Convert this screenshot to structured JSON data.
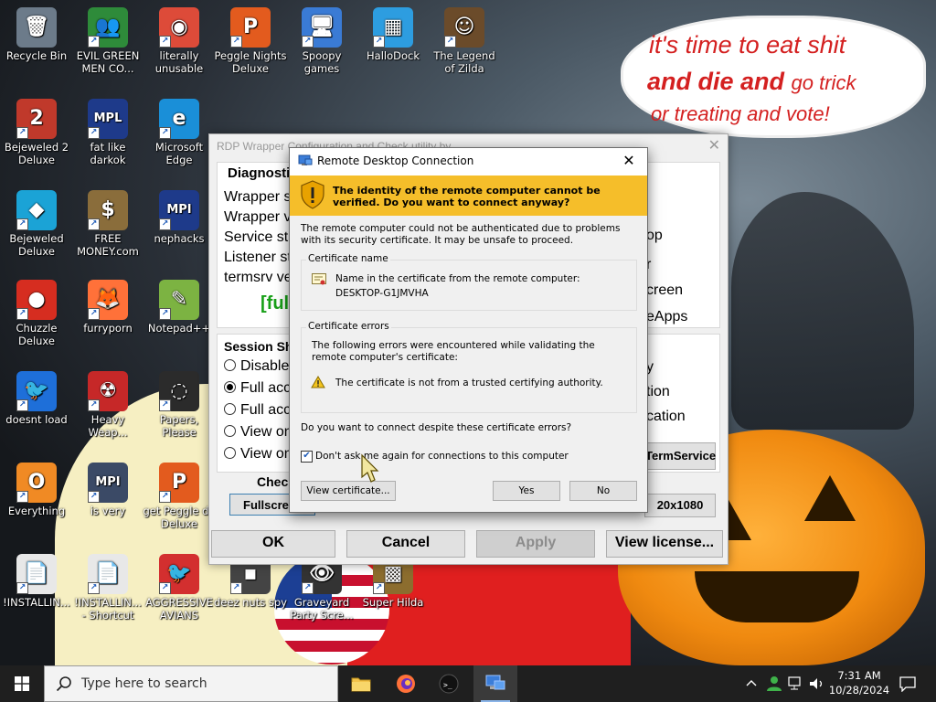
{
  "desktop": {
    "icons": [
      {
        "label": "Recycle Bin",
        "glyph": "🗑",
        "color": "#6c7b8a"
      },
      {
        "label": "EVIL GREEN MEN CO...",
        "glyph": "👥",
        "color": "#2e8b3a"
      },
      {
        "label": "literally unusable",
        "glyph": "◉",
        "color": "#dd4b39"
      },
      {
        "label": "Peggle Nights Deluxe",
        "glyph": "P",
        "color": "#e35b1e"
      },
      {
        "label": "Spoopy games",
        "glyph": "🖥",
        "color": "#3a7bd5"
      },
      {
        "label": "HalloDock",
        "glyph": "▦",
        "color": "#2d9de0"
      },
      {
        "label": "The Legend of Zilda",
        "glyph": "☺",
        "color": "#6b4b2a"
      },
      {
        "label": "Bejeweled 2 Deluxe",
        "glyph": "2",
        "color": "#c0392b"
      },
      {
        "label": "fat like darkok",
        "glyph": "MPL",
        "color": "#1e3a8a"
      },
      {
        "label": "Microsoft Edge",
        "glyph": "e",
        "color": "#1a8fd8"
      },
      {
        "label": "Bejeweled Deluxe",
        "glyph": "◆",
        "color": "#1ba3d6"
      },
      {
        "label": "FREE MONEY.com",
        "glyph": "$",
        "color": "#8a6d3b"
      },
      {
        "label": "nephacks",
        "glyph": "MPI",
        "color": "#1e3a8a"
      },
      {
        "label": "Chuzzle Deluxe",
        "glyph": "●",
        "color": "#d62d20"
      },
      {
        "label": "furryporn",
        "glyph": "🦊",
        "color": "#ff7139"
      },
      {
        "label": "Notepad++",
        "glyph": "✎",
        "color": "#7cb342"
      },
      {
        "label": "doesnt load",
        "glyph": "🐦",
        "color": "#1e6fd9"
      },
      {
        "label": "Heavy Weap...",
        "glyph": "☢",
        "color": "#c62828"
      },
      {
        "label": "Papers, Please",
        "glyph": "◌",
        "color": "#2b2b2b"
      },
      {
        "label": "Everything",
        "glyph": "O",
        "color": "#f08a24"
      },
      {
        "label": "is very",
        "glyph": "MPI",
        "color": "#3b4a66"
      },
      {
        "label": "get Peggle de Deluxe",
        "glyph": "P",
        "color": "#e35b1e"
      },
      {
        "label": "!INSTALLIN...",
        "glyph": "📄",
        "color": "#e8e8e8"
      },
      {
        "label": "!INSTALLIN... - Shortcut",
        "glyph": "📄",
        "color": "#e8e8e8"
      },
      {
        "label": "AGGRESSIVE AVIANS",
        "glyph": "🐦",
        "color": "#d32f2f"
      },
      {
        "label": "deez nuts spy",
        "glyph": "▪",
        "color": "#444"
      },
      {
        "label": "Graveyard Party Scre...",
        "glyph": "👁",
        "color": "#333"
      },
      {
        "label": "Super Hilda",
        "glyph": "▩",
        "color": "#8c6d2e"
      }
    ],
    "bubble": {
      "line1": "it's time to eat shit",
      "line2a": "and die and ",
      "line2b": "go trick",
      "line3": "or treating and vote!"
    }
  },
  "rdp_wrapper": {
    "title": "RDP Wrapper Configuration and Check utility by ...",
    "diag_label": "Diagnostic",
    "left_lines": [
      "Wrapper s",
      "Wrapper v",
      "Service sta",
      "Listener st",
      "termsrv ve"
    ],
    "green_text": "[ful",
    "session_label": "Session Sha",
    "radios": [
      "Disable",
      "Full acc",
      "Full acc",
      "View on",
      "View on"
    ],
    "right_lines": [
      "op",
      "r",
      "creen",
      "eApps",
      "y",
      "tion",
      "cation"
    ],
    "check_label": "Check",
    "fullscreen_btn": "Fullscre",
    "termservice_btn": "TermService",
    "res_btn": "20x1080",
    "ok": "OK",
    "cancel": "Cancel",
    "apply": "Apply",
    "view_license": "View license..."
  },
  "dialog": {
    "title": "Remote Desktop Connection",
    "warning": "The identity of the remote computer cannot be verified. Do you want to connect anyway?",
    "intro": "The remote computer could not be authenticated due to problems with its security certificate. It may be unsafe to proceed.",
    "cert_name_group": "Certificate name",
    "cert_name_label": "Name in the certificate from the remote computer:",
    "cert_name_value": "DESKTOP-G1JMVHA",
    "cert_errors_group": "Certificate errors",
    "cert_errors_intro": "The following errors were encountered while validating the remote computer's certificate:",
    "cert_error_1": "The certificate is not from a trusted certifying authority.",
    "question": "Do you want to connect despite these certificate errors?",
    "dont_ask": "Don't ask me again for connections to this computer",
    "dont_ask_checked": true,
    "view_cert": "View certificate...",
    "yes": "Yes",
    "no": "No"
  },
  "taskbar": {
    "search_placeholder": "Type here to search",
    "time": "7:31 AM",
    "date": "10/28/2024"
  },
  "colors": {
    "warning_band": "#f5be2a",
    "taskbar": "#1f1f1f",
    "bubble_text": "#d42020",
    "green_text": "#18a018"
  }
}
